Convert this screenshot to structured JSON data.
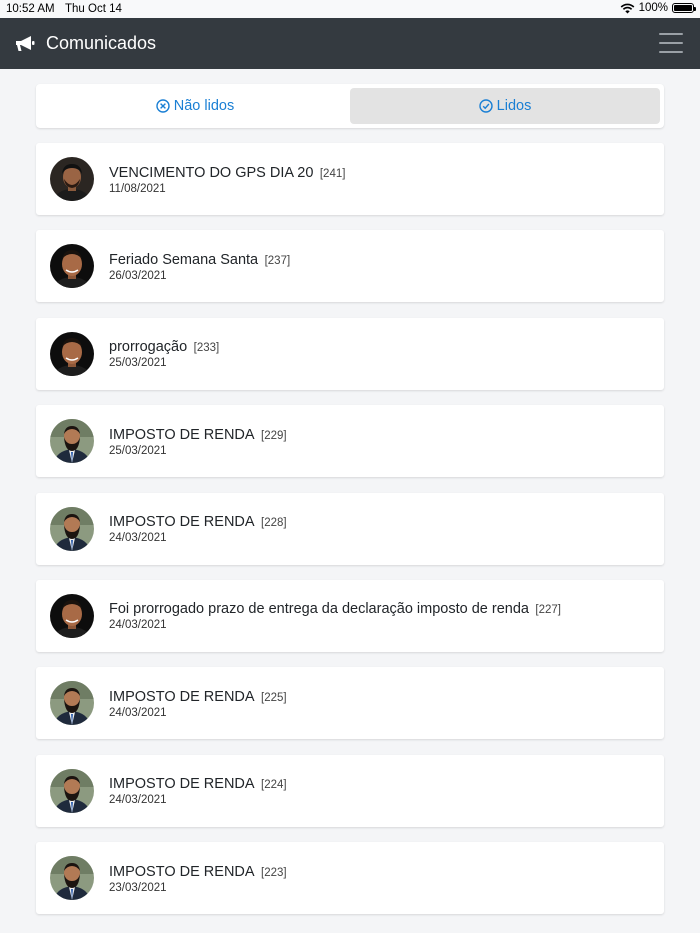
{
  "status_bar": {
    "time": "10:52 AM",
    "date": "Thu Oct 14",
    "battery": "100%"
  },
  "header": {
    "title": "Comunicados",
    "icon": "megaphone-icon",
    "menu_icon": "hamburger-menu-icon"
  },
  "tabs": [
    {
      "label": "Não lidos",
      "icon": "x-circle-icon",
      "active": false
    },
    {
      "label": "Lidos",
      "icon": "check-circle-icon",
      "active": true
    }
  ],
  "items": [
    {
      "title": "VENCIMENTO DO GPS DIA 20",
      "id": "[241]",
      "date": "11/08/2021",
      "avatar": "avatar-a"
    },
    {
      "title": "Feriado Semana Santa",
      "id": "[237]",
      "date": "26/03/2021",
      "avatar": "avatar-b"
    },
    {
      "title": "prorrogação",
      "id": "[233]",
      "date": "25/03/2021",
      "avatar": "avatar-b"
    },
    {
      "title": "IMPOSTO DE RENDA",
      "id": "[229]",
      "date": "25/03/2021",
      "avatar": "avatar-c"
    },
    {
      "title": "IMPOSTO DE RENDA",
      "id": "[228]",
      "date": "24/03/2021",
      "avatar": "avatar-c"
    },
    {
      "title": "Foi prorrogado prazo de entrega da declaração imposto de renda",
      "id": "[227]",
      "date": "24/03/2021",
      "avatar": "avatar-b"
    },
    {
      "title": "IMPOSTO DE RENDA",
      "id": "[225]",
      "date": "24/03/2021",
      "avatar": "avatar-c"
    },
    {
      "title": "IMPOSTO DE RENDA",
      "id": "[224]",
      "date": "24/03/2021",
      "avatar": "avatar-c"
    },
    {
      "title": "IMPOSTO DE RENDA",
      "id": "[223]",
      "date": "23/03/2021",
      "avatar": "avatar-c"
    }
  ],
  "colors": {
    "navbar": "#343a40",
    "accent": "#1a7fd4",
    "background": "#f4f5f7"
  }
}
